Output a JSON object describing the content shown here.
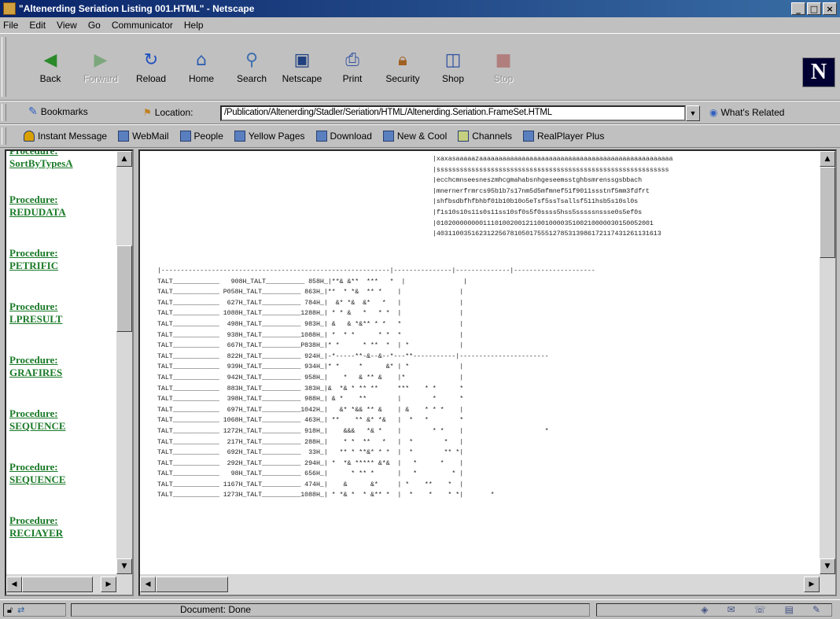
{
  "window": {
    "title": "\"Altenerding Seriation Listing 001.HTML\" - Netscape",
    "buttons": [
      "_",
      "□",
      "×"
    ]
  },
  "menu": [
    "File",
    "Edit",
    "View",
    "Go",
    "Communicator",
    "Help"
  ],
  "nav": {
    "buttons": [
      {
        "label": "Back",
        "icon": "back-arrow",
        "enabled": true
      },
      {
        "label": "Forward",
        "icon": "forward-arrow",
        "enabled": false
      },
      {
        "label": "Reload",
        "icon": "reload",
        "enabled": true
      },
      {
        "label": "Home",
        "icon": "home",
        "enabled": true
      },
      {
        "label": "Search",
        "icon": "search",
        "enabled": true
      },
      {
        "label": "Netscape",
        "icon": "netscape",
        "enabled": true
      },
      {
        "label": "Print",
        "icon": "print",
        "enabled": true
      },
      {
        "label": "Security",
        "icon": "lock",
        "enabled": true
      },
      {
        "label": "Shop",
        "icon": "shop",
        "enabled": true
      },
      {
        "label": "Stop",
        "icon": "stop",
        "enabled": false
      }
    ],
    "logo": "N"
  },
  "location": {
    "bookmarks_label": "Bookmarks",
    "label": "Location:",
    "url": "/Publication/Altenerding/Stadler/Seriation/HTML/Altenerding.Seriation.FrameSet.HTML",
    "related_label": "What's Related"
  },
  "personal": [
    "Instant Message",
    "WebMail",
    "People",
    "Yellow Pages",
    "Download",
    "New & Cool",
    "Channels",
    "RealPlayer Plus"
  ],
  "left_frame": {
    "top_partial": [
      "Procedure:",
      "SortByTypesA"
    ],
    "links": [
      {
        "prefix": "Procedure:",
        "name": "REDUDATA"
      },
      {
        "prefix": "Procedure:",
        "name": "PETRIFIC"
      },
      {
        "prefix": "Procedure:",
        "name": "LPRESULT"
      },
      {
        "prefix": "Procedure:",
        "name": "GRAFIRES"
      },
      {
        "prefix": "Procedure:",
        "name": "SEQUENCE"
      },
      {
        "prefix": "Procedure:",
        "name": "SEQUENCE"
      },
      {
        "prefix": "Procedure:",
        "name": "RECIAYER"
      }
    ]
  },
  "right_frame": {
    "header_text": "|xaxasaaaaazaaaaaaaaaaaaaaaaaaaaaaaaaaaaaaaaaaaaaaaaaaaaaaaaaa\n|ssssssssssssssssssssssssssssssssssssssssssssssssssssssssssss\n|ecchcmnseesneszmhcgmahabsnhgeseemsstghbsmrenssgsbbach\n|mnernerfrmrcs95b1b7s17nm5d5mfmnef51f9011ssstnf5mm3fdfrt\n|shfbsdbfhfbhbf01b10b10o5eTsf5ssTsallsf511hsb5s10sl0s\n|f1s10s10s11s0s11ss10sf0s5f0ssss5hss5sssssnssse0s5ef0s\n|01020000000011101002001211001000035100210000030150052001\n|4031100351623122567810501755512785313986172117431261131613",
    "table_text": "|-----------------------------------------------------------|---------------|--------------|---------------------\nTALT____________   908H_TALT__________ 858H_|**& &**  ***   *  |               |\nTALT____________ P058H_TALT__________ 863H_|**  * *&  ** *    |               |\nTALT____________  627H_TALT__________ 784H_|  &* *&  &*   *   |               |\nTALT____________ 1088H_TALT__________1288H_| * * &   *   * *  |               |\nTALT____________  498H_TALT__________ 983H_| &   & *&** * *   *               |\nTALT____________  938H_TALT__________1088H_| *  * *      * *  *               |\nTALT____________  667H_TALT__________P838H_|* *      * **  *  | *             |\nTALT____________  822H_TALT__________ 924H_|-*-----**-&--&--*---**-----------|-----------------------\nTALT____________  939H_TALT__________ 934H_|* *     *      &* | *             |\nTALT____________  942H_TALT__________ 958H_|    *   & ** &    |*              |\nTALT____________  883H_TALT__________ 383H_|&  *& * ** **     ***    * *      *\nTALT____________  398H_TALT__________ 988H_| & *    **        |        *      *\nTALT____________  697H_TALT__________1042H_|   &* *&& ** &    | &    * * *    |\nTALT____________ 1068H_TALT__________ 463H_| **    ** &* *&   |  *   *        *\nTALT____________ 1272H_TALT__________ 918H_|    &&&   *& *    |        * *    |                     *\nTALT____________  217H_TALT__________ 288H_|    * *  **   *   |  *        *   |\nTALT____________  692H_TALT__________  33H_|   ** * **&* * *  |  *        ** *|\nTALT____________  292H_TALT__________ 294H_| *  *& ***** &*&  |   *      *    |\nTALT____________   98H_TALT__________ 656H_|      * ** *      |   *         * |\nTALT____________ 1167H_TALT__________ 474H_|    &      &*     | *    **    *  |\nTALT____________ 1273H_TALT__________1088H_| * *& *  * &** *  |  *    *    * *|       *"
  },
  "status": {
    "text": "Document: Done"
  }
}
